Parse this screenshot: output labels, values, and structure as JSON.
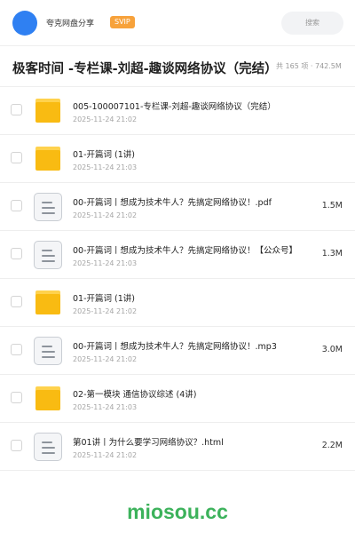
{
  "header": {
    "brand": "夸克网盘分享",
    "badge": "SVIP",
    "search_placeholder": "搜索"
  },
  "folder": {
    "title": "极客时间 -专栏课-刘超-趣谈网络协议（完结）",
    "meta": "共 165 项 · 742.5M"
  },
  "files": [
    {
      "type": "folder",
      "name": "005-100007101-专栏课-刘超-趣谈网络协议（完结）",
      "date": "2025-11-24 21:02",
      "size": ""
    },
    {
      "type": "folder",
      "name": "01-开篇词 (1讲)",
      "date": "2025-11-24 21:03",
      "size": ""
    },
    {
      "type": "doc",
      "name": "00-开篇词丨想成为技术牛人？先搞定网络协议！.pdf",
      "date": "2025-11-24 21:02",
      "size": "1.5M"
    },
    {
      "type": "doc",
      "name": "00-开篇词丨想成为技术牛人？先搞定网络协议！【公众号】",
      "date": "2025-11-24 21:03",
      "size": "1.3M"
    },
    {
      "type": "folder",
      "name": "01-开篇词 (1讲)",
      "date": "2025-11-24 21:02",
      "size": ""
    },
    {
      "type": "doc",
      "name": "00-开篇词丨想成为技术牛人？先搞定网络协议！.mp3",
      "date": "2025-11-24 21:02",
      "size": "3.0M"
    },
    {
      "type": "folder",
      "name": "02-第一模块 通信协议综述 (4讲)",
      "date": "2025-11-24 21:03",
      "size": ""
    },
    {
      "type": "doc",
      "name": "第01讲丨为什么要学习网络协议？.html",
      "date": "2025-11-24 21:02",
      "size": "2.2M"
    }
  ],
  "watermark": "miosou.cc",
  "colors": {
    "avatar": "#2f80f2",
    "badge": "#f7a23b",
    "folder": "#f9bb12",
    "watermark": "#3cb25b"
  }
}
